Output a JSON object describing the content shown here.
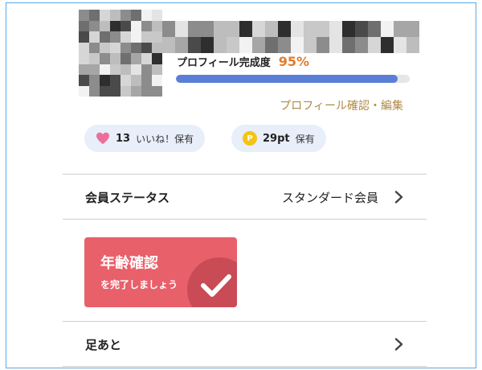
{
  "profile": {
    "completion_label": "プロフィール完成度",
    "completion_value": "95%",
    "completion_fraction": 0.95,
    "edit_link": "プロフィール確認・編集",
    "avatar_icon": "pixelated-avatar-icon",
    "name_icon": "pixelated-name-icon"
  },
  "chips": {
    "likes": {
      "icon": "heart-icon",
      "count": "13",
      "text": "いいね！保有"
    },
    "points": {
      "icon": "point-coin-icon",
      "coin_letter": "P",
      "count": "29pt",
      "text": "保有"
    }
  },
  "member_status": {
    "label": "会員ステータス",
    "value": "スタンダード会員"
  },
  "age_verification": {
    "title": "年齢確認",
    "subtitle": "を完了しましょう"
  },
  "footprints": {
    "label": "足あと"
  },
  "colors": {
    "accent_orange": "#e27a2a",
    "progress_blue": "#5b7fd6",
    "link_gold": "#b08a45",
    "chip_bg": "#e8eefa",
    "card_red": "#e8606a",
    "heart_pink": "#ee6e9a",
    "coin_yellow": "#f4c415"
  }
}
